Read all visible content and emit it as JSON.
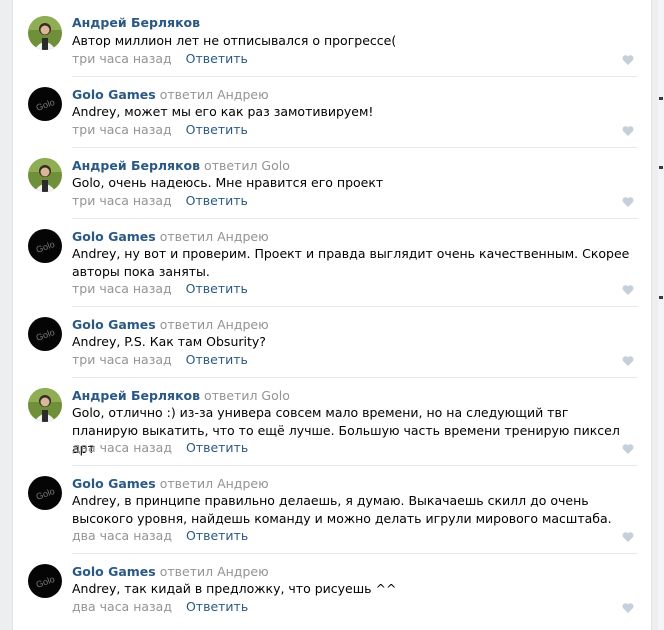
{
  "colors": {
    "author": "#2a5885",
    "muted": "#939393",
    "text": "#000000",
    "heart": "#c5d0db",
    "background": "#edeef0",
    "panel": "#ffffff"
  },
  "icons": {
    "like": "heart-icon"
  },
  "comments": [
    {
      "author": "Андрей Берляков",
      "replied": "",
      "reply_to": "",
      "avatar": "person-photo",
      "text": "Автор миллион лет не отписывался о прогрессе(",
      "time": "три часа назад",
      "reply_label": "Ответить"
    },
    {
      "author": "Golo Games",
      "replied": "ответил",
      "reply_to": "Андрею",
      "avatar": "golo-games-logo",
      "text": "Andrey, может мы его как раз замотивируем!",
      "time": "три часа назад",
      "reply_label": "Ответить"
    },
    {
      "author": "Андрей Берляков",
      "replied": "ответил",
      "reply_to": "Golo",
      "avatar": "person-photo",
      "text": "Golo, очень надеюсь. Мне нравится его проект",
      "time": "три часа назад",
      "reply_label": "Ответить"
    },
    {
      "author": "Golo Games",
      "replied": "ответил",
      "reply_to": "Андрею",
      "avatar": "golo-games-logo",
      "text": "Andrey, ну вот и проверим. Проект и правда выглядит очень качественным. Скорее авторы пока заняты.",
      "time": "три часа назад",
      "reply_label": "Ответить"
    },
    {
      "author": "Golo Games",
      "replied": "ответил",
      "reply_to": "Андрею",
      "avatar": "golo-games-logo",
      "text": "Andrey, P.S. Как там Obsurity?",
      "time": "три часа назад",
      "reply_label": "Ответить"
    },
    {
      "author": "Андрей Берляков",
      "replied": "ответил",
      "reply_to": "Golo",
      "avatar": "person-photo",
      "text": "Golo, отлично :) из-за универа совсем мало времени, но на следующий твг планирую выкатить, что то ещё лучше. Большую часть времени тренирую пиксел арт",
      "time": "два часа назад",
      "reply_label": "Ответить"
    },
    {
      "author": "Golo Games",
      "replied": "ответил",
      "reply_to": "Андрею",
      "avatar": "golo-games-logo",
      "text": "Andrey, в принципе правильно делаешь, я думаю. Выкачаешь скилл до очень высокого уровня, найдешь команду и можно делать игрули мирового масштаба.",
      "time": "два часа назад",
      "reply_label": "Ответить"
    },
    {
      "author": "Golo Games",
      "replied": "ответил",
      "reply_to": "Андрею",
      "avatar": "golo-games-logo",
      "text": "Andrey, так кидай в предложку, что рисуешь ^^",
      "time": "два часа назад",
      "reply_label": "Ответить"
    }
  ]
}
